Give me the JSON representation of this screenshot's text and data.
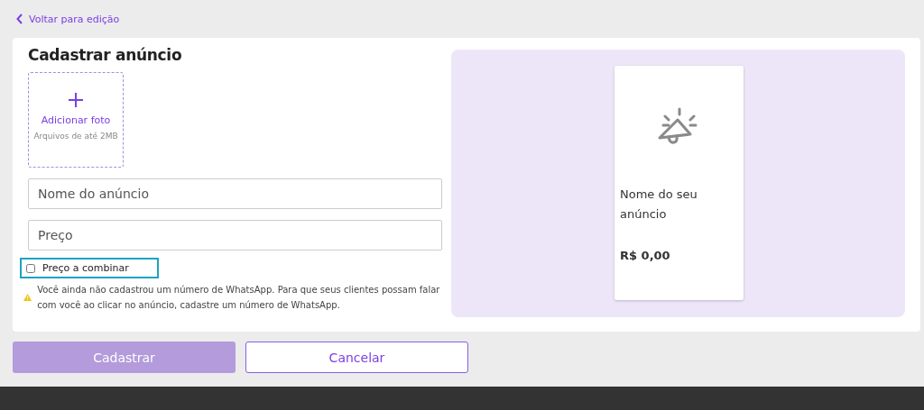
{
  "back_link": {
    "label": "Voltar para edição"
  },
  "form": {
    "title": "Cadastrar anúncio",
    "photo_upload": {
      "label": "Adicionar foto",
      "hint": "Arquivos de até 2MB"
    },
    "fields": [
      {
        "placeholder": "Nome do anúncio"
      },
      {
        "placeholder": "Preço"
      }
    ],
    "negotiable": {
      "label": "Preço a combinar",
      "checked": false
    },
    "warning": "Você ainda não cadastrou um número de WhatsApp. Para que seus clientes possam falar com você ao clicar no anúncio, cadastre um número de WhatsApp."
  },
  "preview": {
    "name": "Nome do seu anúncio",
    "price": "R$ 0,00"
  },
  "buttons": [
    {
      "label": "Cadastrar",
      "kind": "primary",
      "disabled": true
    },
    {
      "label": "Cancelar",
      "kind": "secondary",
      "disabled": false
    }
  ]
}
